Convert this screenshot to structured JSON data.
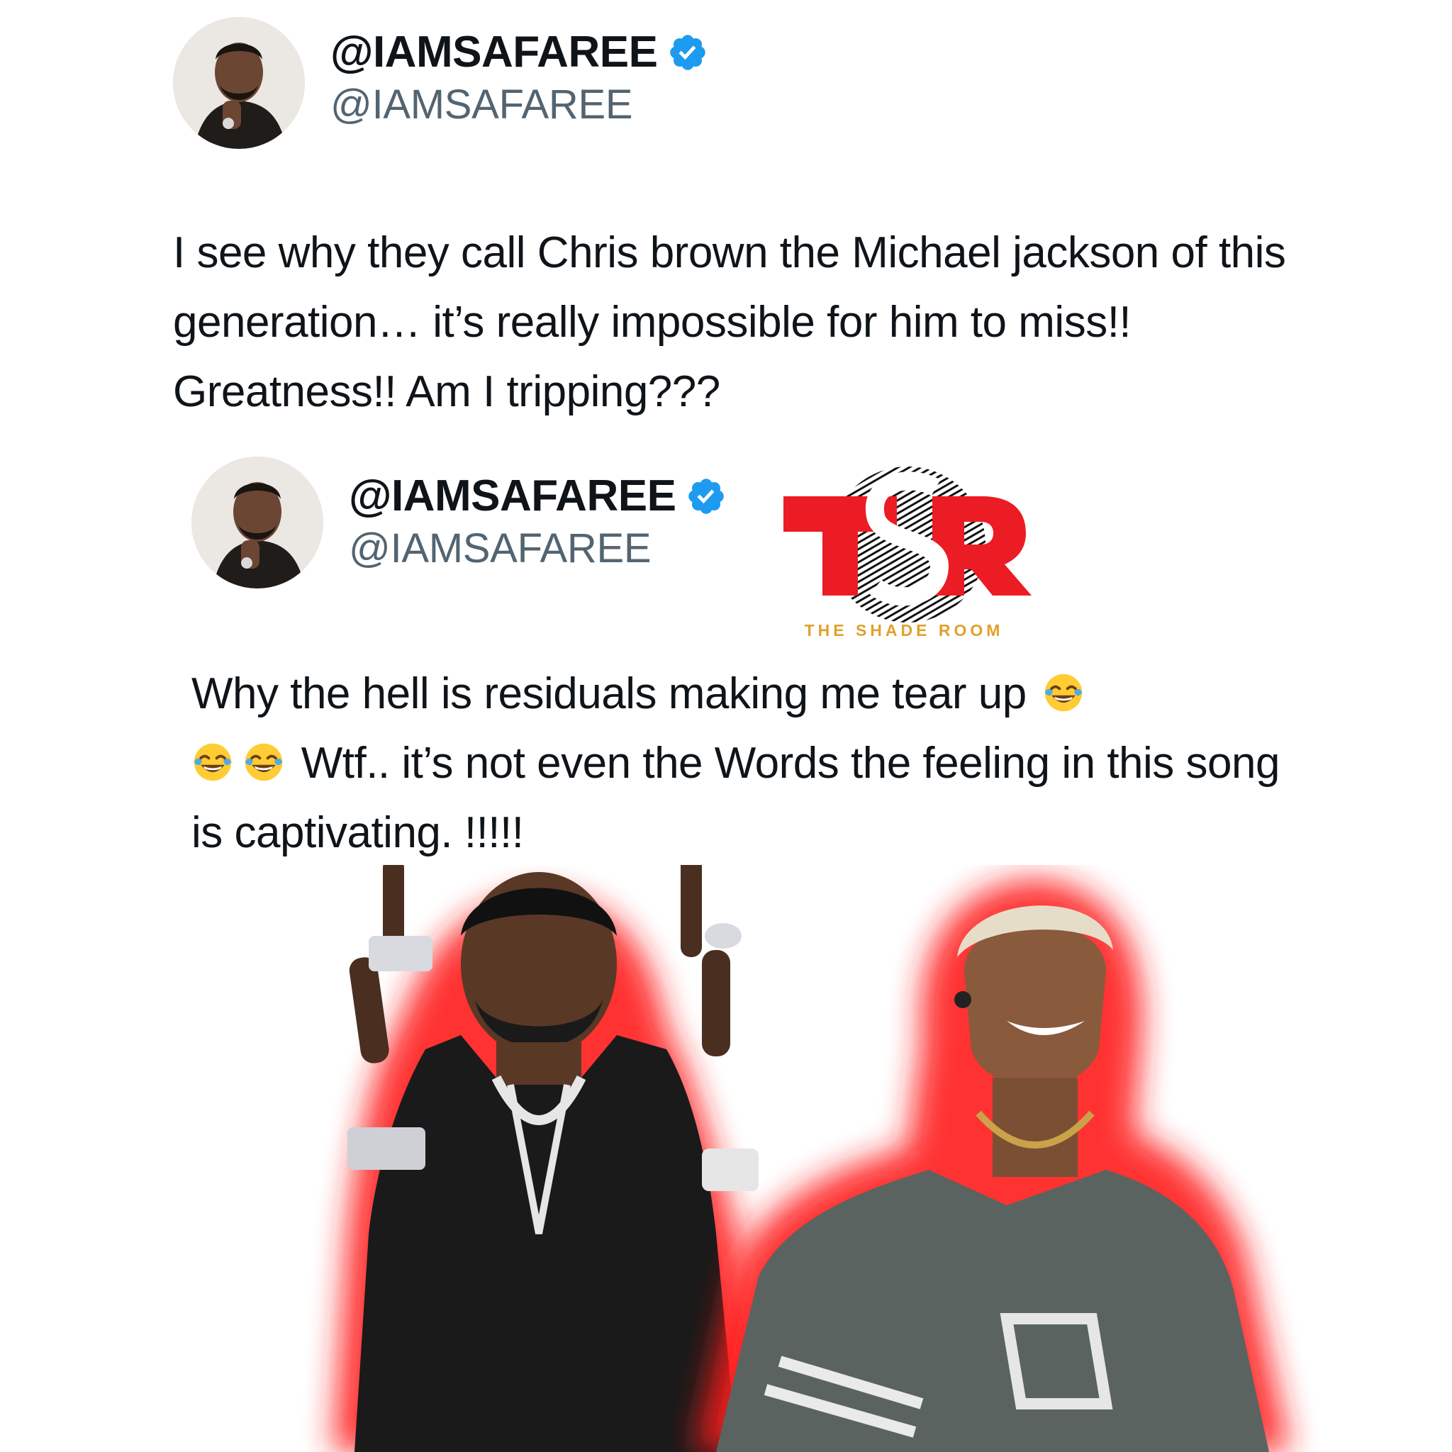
{
  "tweet_1": {
    "display_name": "@IAMSAFAREE",
    "handle": "@IAMSAFAREE",
    "verified_icon": "verified-badge-icon",
    "text": "I see why they call Chris brown the Michael jackson of this generation… it’s really impossible for him to miss!! Greatness!! Am I tripping???"
  },
  "tweet_2": {
    "display_name": "@IAMSAFAREE",
    "handle": "@IAMSAFAREE",
    "verified_icon": "verified-badge-icon",
    "text_part_1": "Why the hell is residuals making me tear up",
    "text_part_2": "Wtf.. it’s not even the Words the feeling in this song is captivating. !!!!!",
    "emoji_icon": "tears-of-joy-emoji"
  },
  "watermark": {
    "logo_letters": "TSR",
    "caption": "THE SHADE ROOM",
    "brand_red": "#ec1c24",
    "brand_gold": "#e0a12c"
  },
  "colors": {
    "background": "#ffffff",
    "text": "#0f1419",
    "handle": "#536471",
    "verified": "#1d9bf0",
    "glow": "#ff1a1a"
  }
}
